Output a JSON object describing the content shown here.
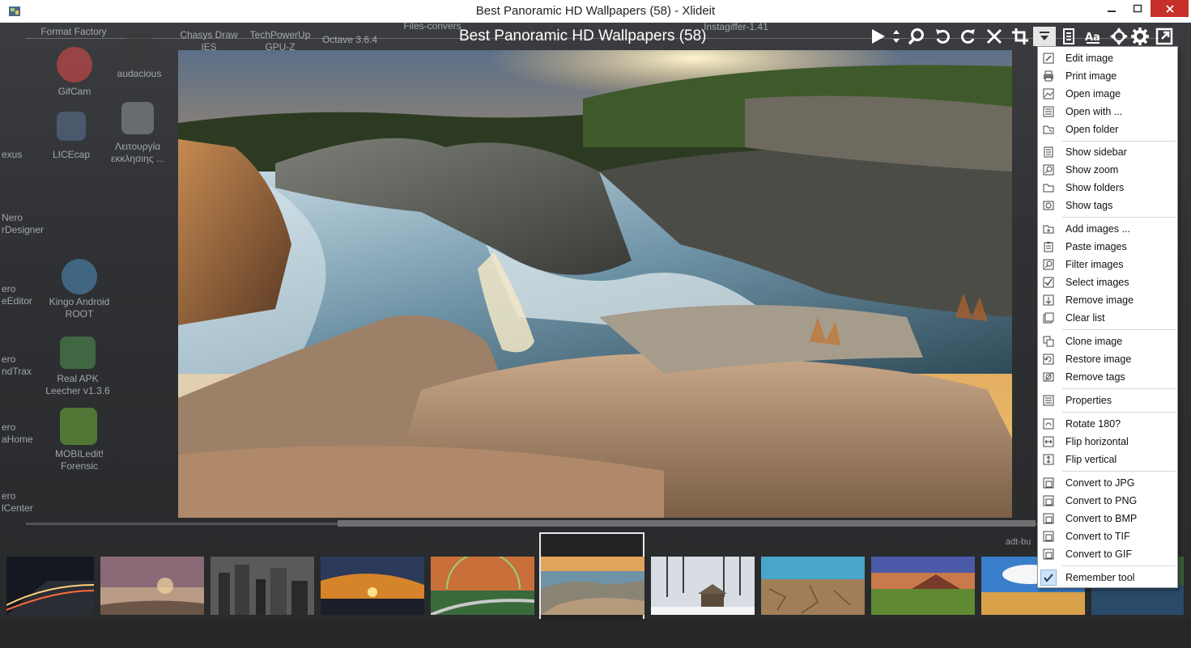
{
  "window": {
    "title": "Best Panoramic HD Wallpapers  (58) - Xlideit"
  },
  "viewer": {
    "album_title": "Best Panoramic HD Wallpapers  (58)"
  },
  "toolbar": {
    "buttons": [
      "play-icon",
      "sort-icon",
      "zoom-icon",
      "rotate-left-icon",
      "rotate-right-icon",
      "close-icon",
      "crop-icon",
      "dropdown-icon",
      "list-icon",
      "text-size-icon",
      "move-icon",
      "settings-icon",
      "fullscreen-icon"
    ]
  },
  "desktop": {
    "labels": [
      {
        "text": "Format Factory"
      },
      {
        "text": "Chasys Draw IES"
      },
      {
        "text": "TechPowerUp GPU-Z"
      },
      {
        "text": "Octave 3.6.4"
      },
      {
        "text": "Files-convers"
      },
      {
        "text": "audacious"
      },
      {
        "text": "GifCam"
      },
      {
        "text": "LICEcap"
      },
      {
        "text": "Λειτουργία εκκλησιης ..."
      },
      {
        "text": "Kingo Android ROOT"
      },
      {
        "text": "Real APK Leecher v1.3.6"
      },
      {
        "text": "MOBILedit! Forensic"
      },
      {
        "text": "exus"
      },
      {
        "text": "Nero rDesigner"
      },
      {
        "text": "ero eEditor"
      },
      {
        "text": "ero ndTrax"
      },
      {
        "text": "ero aHome"
      },
      {
        "text": "ero lCenter"
      },
      {
        "text": "Instagiffer-1.41"
      }
    ],
    "adt_label": "adt-bu"
  },
  "menu": {
    "items": [
      {
        "label": "Edit image",
        "icon": "edit-icon"
      },
      {
        "label": "Print image",
        "icon": "print-icon"
      },
      {
        "label": "Open image",
        "icon": "open-image-icon"
      },
      {
        "label": "Open with ...",
        "icon": "open-with-icon"
      },
      {
        "label": "Open folder",
        "icon": "open-folder-icon"
      },
      {
        "label": "Show sidebar",
        "icon": "sidebar-icon"
      },
      {
        "label": "Show zoom",
        "icon": "zoom-icon"
      },
      {
        "label": "Show folders",
        "icon": "folders-icon"
      },
      {
        "label": "Show tags",
        "icon": "tags-icon"
      },
      {
        "label": "Add images ...",
        "icon": "add-images-icon"
      },
      {
        "label": "Paste images",
        "icon": "paste-icon"
      },
      {
        "label": "Filter images",
        "icon": "filter-icon"
      },
      {
        "label": "Select images",
        "icon": "select-icon"
      },
      {
        "label": "Remove image",
        "icon": "remove-image-icon"
      },
      {
        "label": "Clear list",
        "icon": "clear-list-icon"
      },
      {
        "label": "Clone image",
        "icon": "clone-icon"
      },
      {
        "label": "Restore image",
        "icon": "restore-icon"
      },
      {
        "label": "Remove tags",
        "icon": "remove-tags-icon"
      },
      {
        "label": "Properties",
        "icon": "properties-icon"
      },
      {
        "label": "Rotate 180?",
        "icon": "rotate-180-icon"
      },
      {
        "label": "Flip horizontal",
        "icon": "flip-horizontal-icon"
      },
      {
        "label": "Flip vertical",
        "icon": "flip-vertical-icon"
      },
      {
        "label": "Convert to JPG",
        "icon": "convert-jpg-icon"
      },
      {
        "label": "Convert to PNG",
        "icon": "convert-png-icon"
      },
      {
        "label": "Convert to BMP",
        "icon": "convert-bmp-icon"
      },
      {
        "label": "Convert to TIF",
        "icon": "convert-tif-icon"
      },
      {
        "label": "Convert to GIF",
        "icon": "convert-gif-icon"
      },
      {
        "label": "Remember tool",
        "icon": "check-icon",
        "checked": true
      }
    ]
  },
  "thumbnails": {
    "count_visible": 11,
    "selected_index": 5,
    "items": [
      {
        "subject": "night road"
      },
      {
        "subject": "beach sunset"
      },
      {
        "subject": "city skyline bw"
      },
      {
        "subject": "sunset clouds"
      },
      {
        "subject": "rainbow road"
      },
      {
        "subject": "river rocks"
      },
      {
        "subject": "snow cabin"
      },
      {
        "subject": "cracked desert"
      },
      {
        "subject": "pier sunset"
      },
      {
        "subject": "wheat field"
      },
      {
        "subject": "village lake"
      }
    ]
  },
  "colors": {
    "menu_check_bg": "#cfe3f6",
    "close_button": "#c7302a"
  }
}
